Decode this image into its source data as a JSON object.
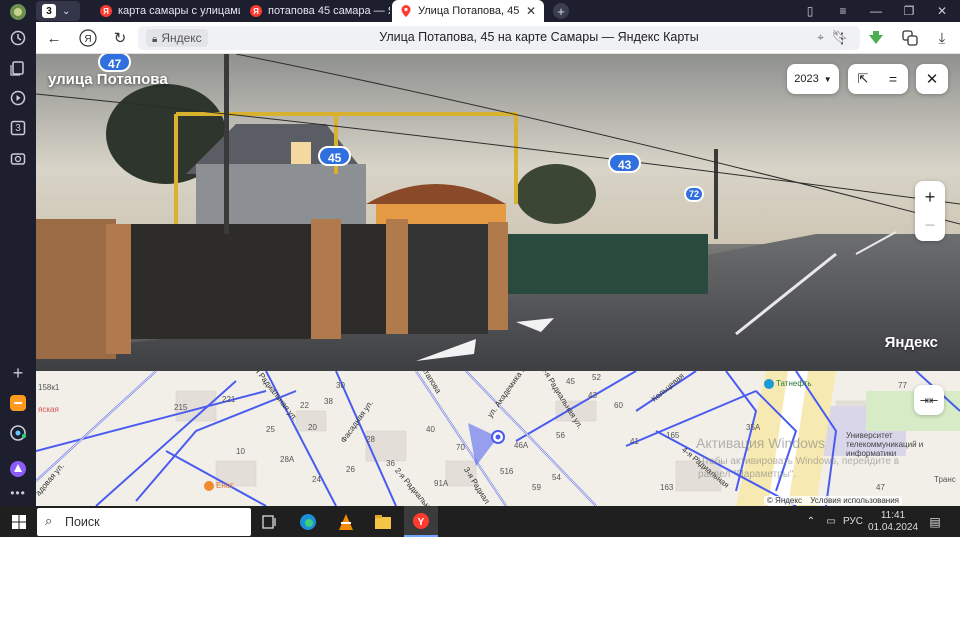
{
  "sidebar": {
    "tab_count": "3",
    "icons": [
      "history-icon",
      "collections-icon",
      "video-icon",
      "tab-counter-icon",
      "screenshot-icon",
      "add-icon",
      "zen-icon",
      "messenger-icon",
      "alice-icon",
      "more-icon"
    ]
  },
  "tabs": [
    {
      "title": "карта самары с улицами",
      "favicon": "yandex-icon",
      "active": false
    },
    {
      "title": "потапова 45 самара — Ян",
      "favicon": "yandex-icon",
      "active": false
    },
    {
      "title": "Улица Потапова, 45 на",
      "favicon": "maps-pin-icon",
      "active": true
    }
  ],
  "address_bar": {
    "domain": "Яндекс",
    "page_title": "Улица Потапова, 45 на карте Самары — Яндекс Карты"
  },
  "panorama": {
    "street_name": "улица Потапова",
    "year": "2023",
    "house_numbers": [
      "47",
      "45",
      "43",
      "72"
    ],
    "watermark": "Яндекс",
    "zoom_in": "+",
    "zoom_out": "−"
  },
  "map": {
    "streets": [
      "Потапова",
      "5-я Радиальная ул.",
      "2-я Радиальная ул.",
      "Фасадная ул.",
      "ул. Академика П",
      "3-я Радиал",
      "Кольцевая",
      "2-я Радиальная",
      "4-я Радиальная",
      "адовая ул."
    ],
    "numbers": [
      "158к1",
      "215",
      "221",
      "10",
      "20",
      "22",
      "30",
      "38",
      "40",
      "25",
      "28",
      "36",
      "26",
      "28А",
      "24",
      "70",
      "45",
      "52",
      "43",
      "41",
      "46А",
      "516",
      "54",
      "91А",
      "56",
      "59",
      "60",
      "165",
      "163",
      "35А",
      "77",
      "47"
    ],
    "pois": [
      "Енот",
      "Татнефть",
      "Университет телекоммуникаций и информатики"
    ],
    "labels_misc": [
      "Транс",
      "яская"
    ],
    "activation_title": "Активация Windows",
    "activation_sub": "Чтобы активировать Windows, перейдите в раздел \"Параметры\".",
    "copyright": "© Яндекс",
    "terms": "Условия использования"
  },
  "taskbar": {
    "search_placeholder": "Поиск",
    "language": "РУС",
    "time": "11:41",
    "date": "01.04.2024"
  },
  "colors": {
    "road_blue": "#4a5cf0",
    "badge_blue": "#2f6fde",
    "yandex_red": "#ff3b30"
  }
}
